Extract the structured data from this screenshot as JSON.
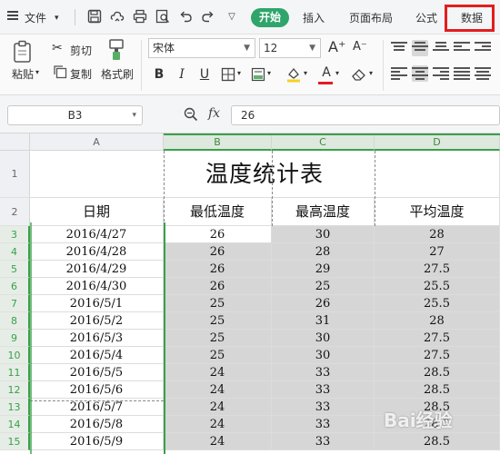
{
  "menubar": {
    "file_label": "文件",
    "tabs": [
      {
        "label": "开始",
        "active": true
      },
      {
        "label": "插入"
      },
      {
        "label": "页面布局"
      },
      {
        "label": "公式"
      },
      {
        "label": "数据",
        "highlighted": true
      }
    ],
    "quick_icons": [
      "save-icon",
      "cloud-icon",
      "print-icon",
      "print-preview-icon",
      "undo-icon",
      "redo-icon",
      "more-icon"
    ]
  },
  "ribbon": {
    "paste_label": "粘贴",
    "cut_label": "剪切",
    "copy_label": "复制",
    "format_painter_label": "格式刷",
    "font_name": "宋体",
    "font_size": "12",
    "bold_label": "B",
    "italic_label": "I",
    "underline_label": "U",
    "font_color_label": "A",
    "increase_font_label": "A⁺",
    "decrease_font_label": "A⁻"
  },
  "formula_bar": {
    "name_box": "B3",
    "fx_label": "fx",
    "formula": "26"
  },
  "sheet": {
    "columns": [
      "A",
      "B",
      "C",
      "D"
    ],
    "selected_columns": [
      "B",
      "C",
      "D"
    ],
    "title": "温度统计表",
    "headers": [
      "日期",
      "最低温度",
      "最高温度",
      "平均温度"
    ],
    "rows": [
      {
        "num": "3",
        "date": "2016/4/27",
        "low": "26",
        "high": "30",
        "avg": "28"
      },
      {
        "num": "4",
        "date": "2016/4/28",
        "low": "26",
        "high": "28",
        "avg": "27"
      },
      {
        "num": "5",
        "date": "2016/4/29",
        "low": "26",
        "high": "29",
        "avg": "27.5"
      },
      {
        "num": "6",
        "date": "2016/4/30",
        "low": "26",
        "high": "25",
        "avg": "25.5"
      },
      {
        "num": "7",
        "date": "2016/5/1",
        "low": "25",
        "high": "26",
        "avg": "25.5"
      },
      {
        "num": "8",
        "date": "2016/5/2",
        "low": "25",
        "high": "31",
        "avg": "28"
      },
      {
        "num": "9",
        "date": "2016/5/3",
        "low": "25",
        "high": "30",
        "avg": "27.5"
      },
      {
        "num": "10",
        "date": "2016/5/4",
        "low": "25",
        "high": "30",
        "avg": "27.5"
      },
      {
        "num": "11",
        "date": "2016/5/5",
        "low": "24",
        "high": "33",
        "avg": "28.5"
      },
      {
        "num": "12",
        "date": "2016/5/6",
        "low": "24",
        "high": "33",
        "avg": "28.5"
      },
      {
        "num": "13",
        "date": "2016/5/7",
        "low": "24",
        "high": "33",
        "avg": "28.5"
      },
      {
        "num": "14",
        "date": "2016/5/8",
        "low": "24",
        "high": "33",
        "avg": "28.5"
      },
      {
        "num": "15",
        "date": "2016/5/9",
        "low": "24",
        "high": "33",
        "avg": "28.5"
      }
    ],
    "title_row_num": "1",
    "header_row_num": "2"
  },
  "watermark": "Bai经验",
  "colors": {
    "accent": "#2fa56b",
    "selection": "#3aa04a",
    "highlight_box": "#e31d1d",
    "shaded_cell": "#d6d6d6"
  }
}
